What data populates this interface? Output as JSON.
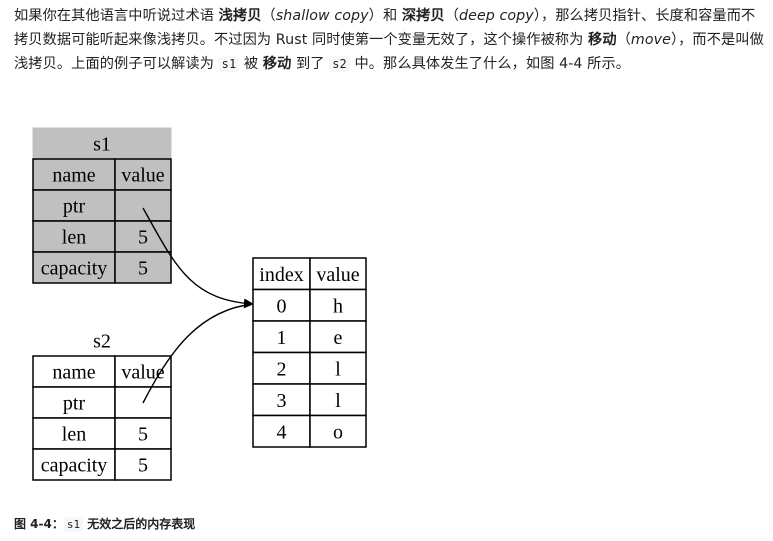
{
  "paragraph": {
    "t1": "如果你在其他语言中听说过术语 ",
    "shallow_copy_cn": "浅拷贝",
    "t2": "（",
    "shallow_copy_en": "shallow copy",
    "t3": "）和 ",
    "deep_copy_cn": "深拷贝",
    "t4": "（",
    "deep_copy_en": "deep copy",
    "t5": "），那么拷贝指针、长度和容量而不拷贝数据可能听起来像浅拷贝。不过因为 Rust 同时使第一个变量无效了，这个操作被称为 ",
    "move_cn": "移动",
    "t6": "（",
    "move_en": "move",
    "t7": "），而不是叫做浅拷贝。上面的例子可以解读为 ",
    "code_s1": "s1",
    "t8": " 被 ",
    "move_cn_2": "移动",
    "t9": " 到了 ",
    "code_s2": "s2",
    "t10": " 中。那么具体发生了什么，如图 4-4 所示。"
  },
  "diagram": {
    "s1": {
      "title": "s1",
      "header": [
        "name",
        "value"
      ],
      "rows": [
        {
          "name": "ptr",
          "value": ""
        },
        {
          "name": "len",
          "value": "5"
        },
        {
          "name": "capacity",
          "value": "5"
        }
      ],
      "fill": "#c0c0c0"
    },
    "s2": {
      "title": "s2",
      "header": [
        "name",
        "value"
      ],
      "rows": [
        {
          "name": "ptr",
          "value": ""
        },
        {
          "name": "len",
          "value": "5"
        },
        {
          "name": "capacity",
          "value": "5"
        }
      ],
      "fill": "#ffffff"
    },
    "heap": {
      "header": [
        "index",
        "value"
      ],
      "rows": [
        {
          "index": "0",
          "value": "h"
        },
        {
          "index": "1",
          "value": "e"
        },
        {
          "index": "2",
          "value": "l"
        },
        {
          "index": "3",
          "value": "l"
        },
        {
          "index": "4",
          "value": "o"
        }
      ]
    }
  },
  "caption": {
    "prefix": "图 4-4：",
    "code": "s1",
    "suffix": " 无效之后的内存表现"
  }
}
